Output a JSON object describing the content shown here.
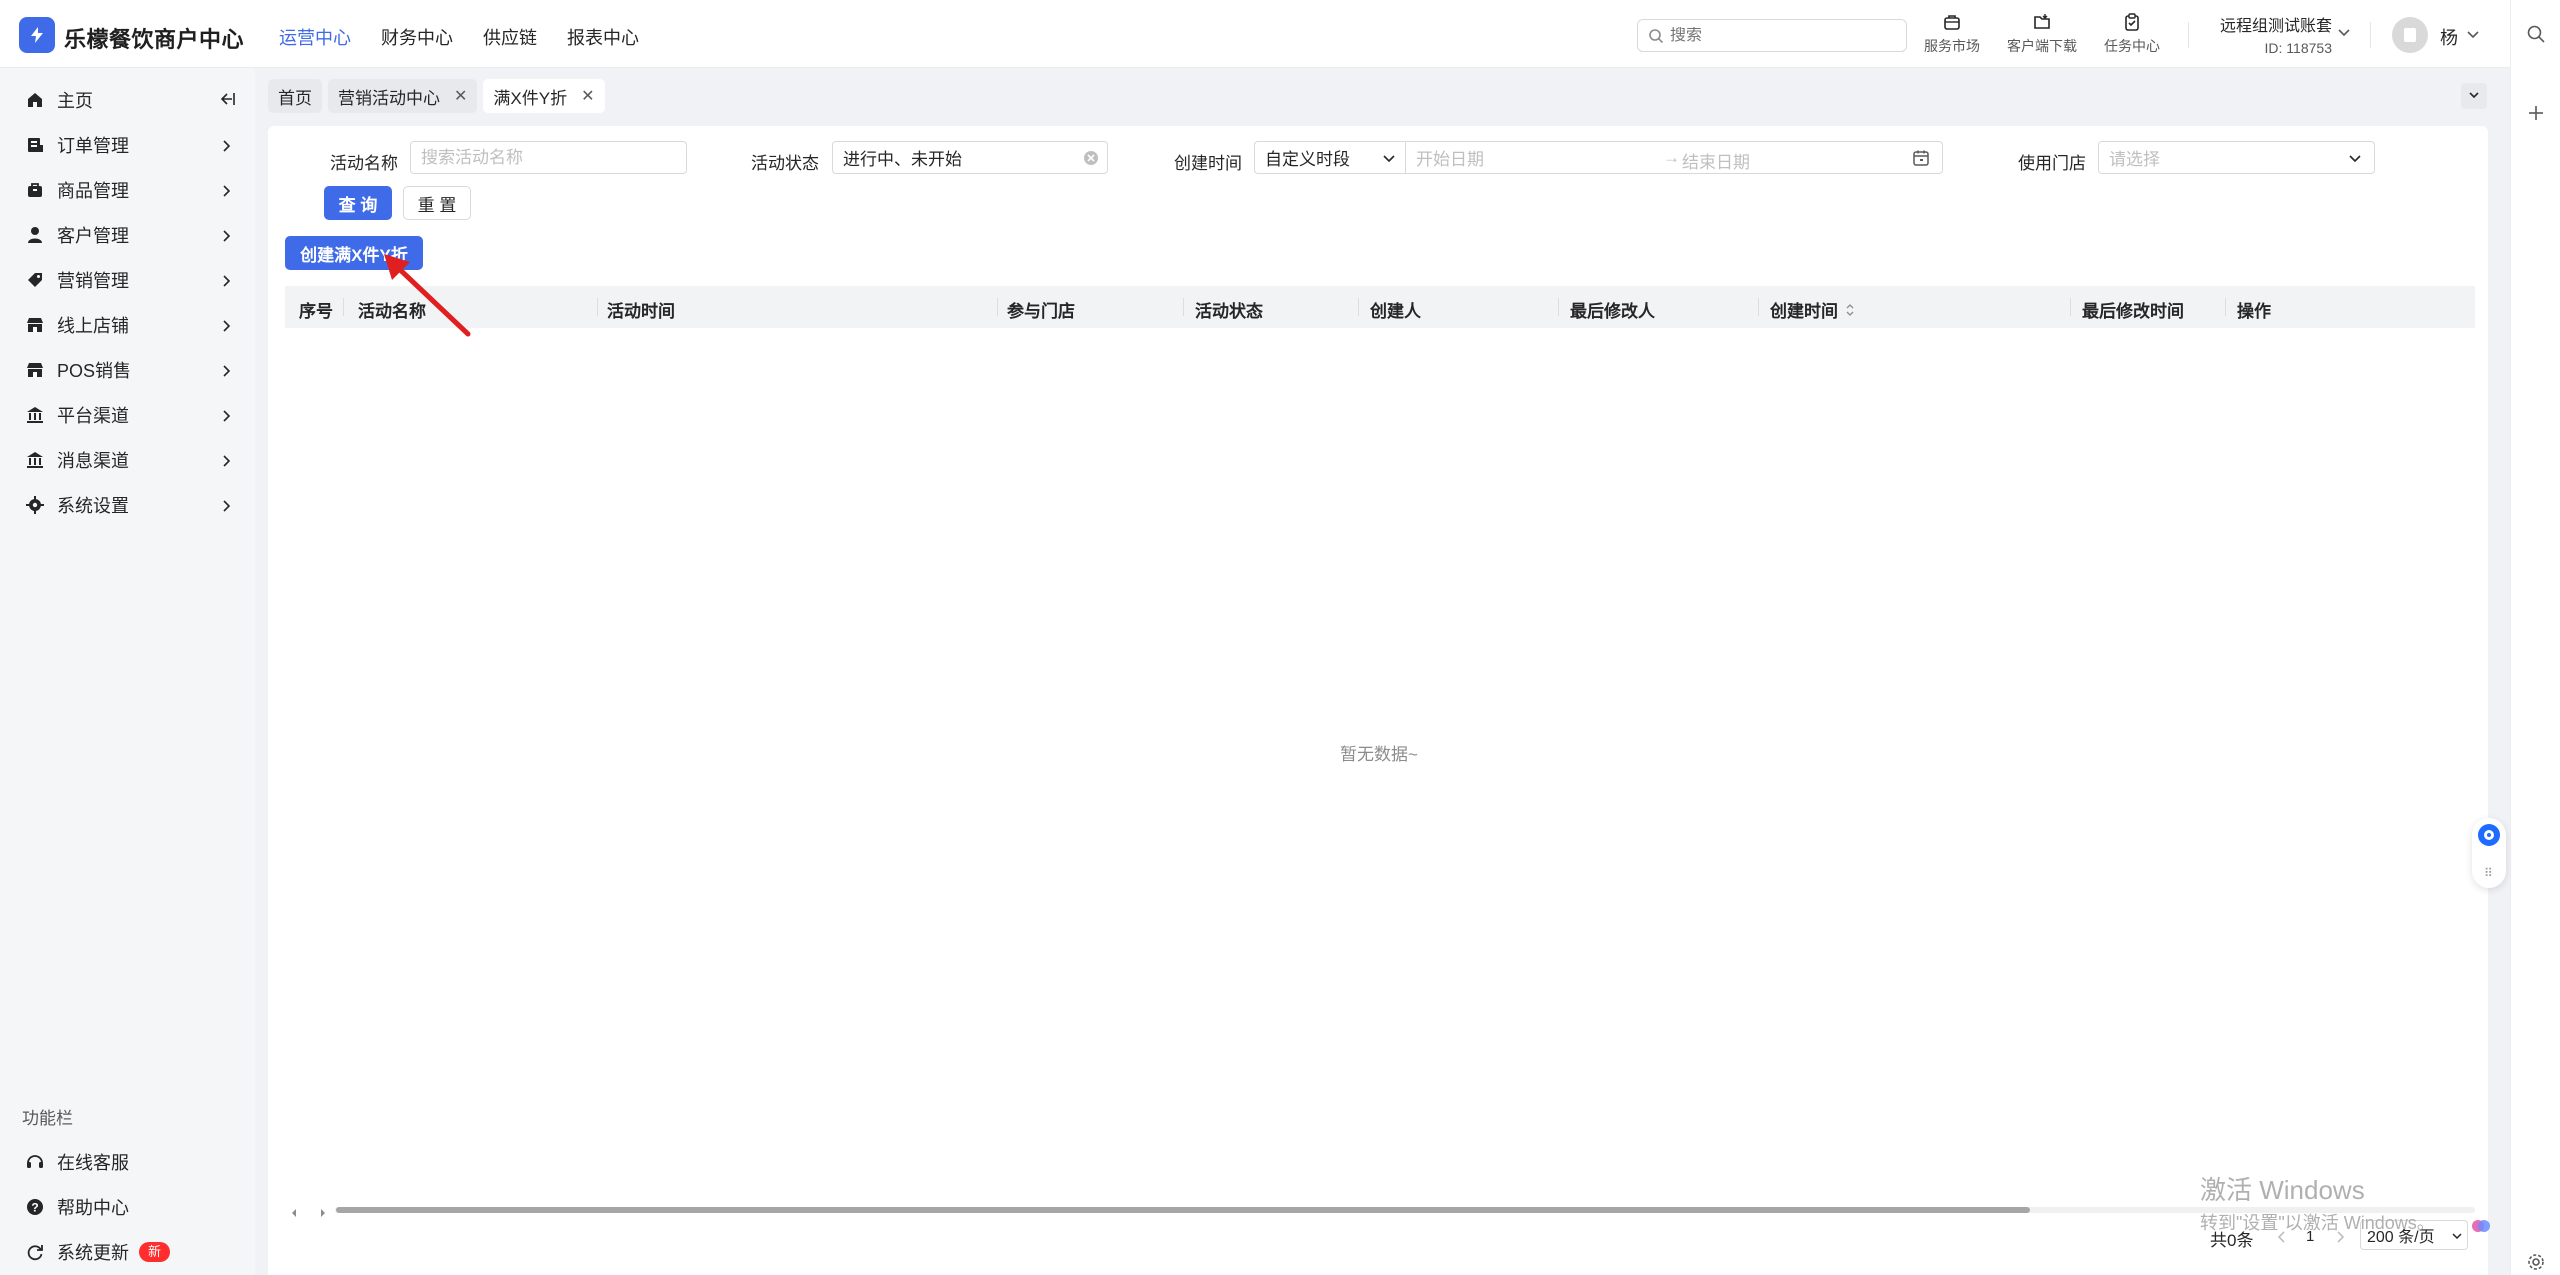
{
  "app": {
    "brand": "乐檬餐饮商户中心",
    "nav": [
      {
        "label": "运营中心",
        "active": true
      },
      {
        "label": "财务中心",
        "active": false
      },
      {
        "label": "供应链",
        "active": false
      },
      {
        "label": "报表中心",
        "active": false
      }
    ],
    "search_placeholder": "搜索",
    "tools": [
      {
        "label": "服务市场",
        "icon": "market-icon"
      },
      {
        "label": "客户端下载",
        "icon": "download-icon"
      },
      {
        "label": "任务中心",
        "icon": "task-icon"
      }
    ],
    "account_name": "远程组测试账套",
    "account_id": "ID: 118753",
    "user_name": "杨"
  },
  "sidebar": {
    "items": [
      {
        "label": "主页",
        "icon": "home-icon"
      },
      {
        "label": "订单管理",
        "icon": "order-icon"
      },
      {
        "label": "商品管理",
        "icon": "goods-icon"
      },
      {
        "label": "客户管理",
        "icon": "user-icon"
      },
      {
        "label": "营销管理",
        "icon": "tag-icon"
      },
      {
        "label": "线上店铺",
        "icon": "shop-icon"
      },
      {
        "label": "POS销售",
        "icon": "pos-icon"
      },
      {
        "label": "平台渠道",
        "icon": "bank-icon"
      },
      {
        "label": "消息渠道",
        "icon": "message-icon"
      },
      {
        "label": "系统设置",
        "icon": "gear-icon"
      }
    ],
    "section_title": "功能栏",
    "bottom_items": [
      {
        "label": "在线客服",
        "icon": "headset-icon"
      },
      {
        "label": "帮助中心",
        "icon": "help-icon"
      },
      {
        "label": "系统更新",
        "icon": "refresh-icon",
        "badge": "新"
      }
    ]
  },
  "tabs": [
    {
      "label": "首页",
      "closable": false,
      "active": false
    },
    {
      "label": "营销活动中心",
      "closable": true,
      "active": false
    },
    {
      "label": "满X件Y折",
      "closable": true,
      "active": true
    }
  ],
  "filters": {
    "name_label": "活动名称",
    "name_placeholder": "搜索活动名称",
    "status_label": "活动状态",
    "status_value": "进行中、未开始",
    "created_label": "创建时间",
    "period_value": "自定义时段",
    "start_placeholder": "开始日期",
    "end_placeholder": "结束日期",
    "range_sep": "→",
    "store_label": "使用门店",
    "store_placeholder": "请选择",
    "query_button": "查 询",
    "reset_button": "重 置"
  },
  "create_button": "创建满X件Y折",
  "table": {
    "columns": [
      "序号",
      "活动名称",
      "活动时间",
      "参与门店",
      "活动状态",
      "创建人",
      "最后修改人",
      "创建时间",
      "最后修改时间",
      "操作"
    ],
    "empty_text": "暂无数据~"
  },
  "pagination": {
    "total": "共0条",
    "page": "1",
    "page_size": "200 条/页"
  },
  "watermark": {
    "line1": "激活 Windows",
    "line2": "转到\"设置\"以激活 Windows。"
  },
  "colors": {
    "primary": "#3f6ae8",
    "badge": "#ff2d2d",
    "annotation_arrow": "#e02020"
  }
}
